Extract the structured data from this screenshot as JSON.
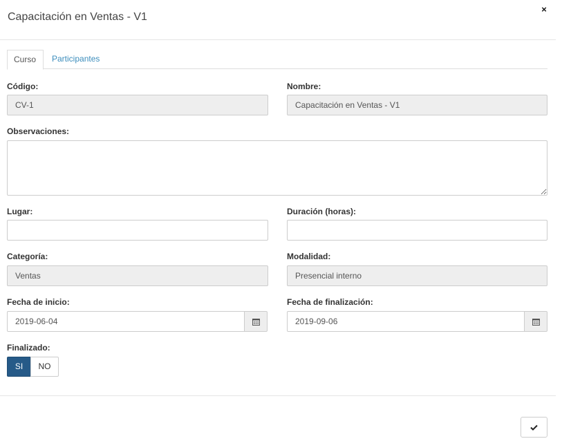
{
  "modal": {
    "title": "Capacitación en Ventas - V1",
    "close_glyph": "×"
  },
  "tabs": [
    {
      "label": "Curso",
      "active": true
    },
    {
      "label": "Participantes",
      "active": false
    }
  ],
  "form": {
    "codigo": {
      "label": "Código:",
      "value": "CV-1"
    },
    "nombre": {
      "label": "Nombre:",
      "value": "Capacitación en Ventas - V1"
    },
    "observaciones": {
      "label": "Observaciones:",
      "value": ""
    },
    "lugar": {
      "label": "Lugar:",
      "value": ""
    },
    "duracion": {
      "label": "Duración (horas):",
      "value": ""
    },
    "categoria": {
      "label": "Categoría:",
      "value": "Ventas"
    },
    "modalidad": {
      "label": "Modalidad:",
      "value": "Presencial interno"
    },
    "fecha_inicio": {
      "label": "Fecha de inicio:",
      "value": "2019-06-04"
    },
    "fecha_fin": {
      "label": "Fecha de finalización:",
      "value": "2019-09-06"
    },
    "finalizado": {
      "label": "Finalizado:",
      "options": [
        "SI",
        "NO"
      ],
      "selected": "SI"
    }
  },
  "icons": {
    "calendar": "calendar-icon",
    "check": "check-icon",
    "close": "close-icon"
  },
  "colors": {
    "accent": "#3c8dbc",
    "primary_toggle": "#265a88",
    "readonly_bg": "#eeeeee"
  }
}
